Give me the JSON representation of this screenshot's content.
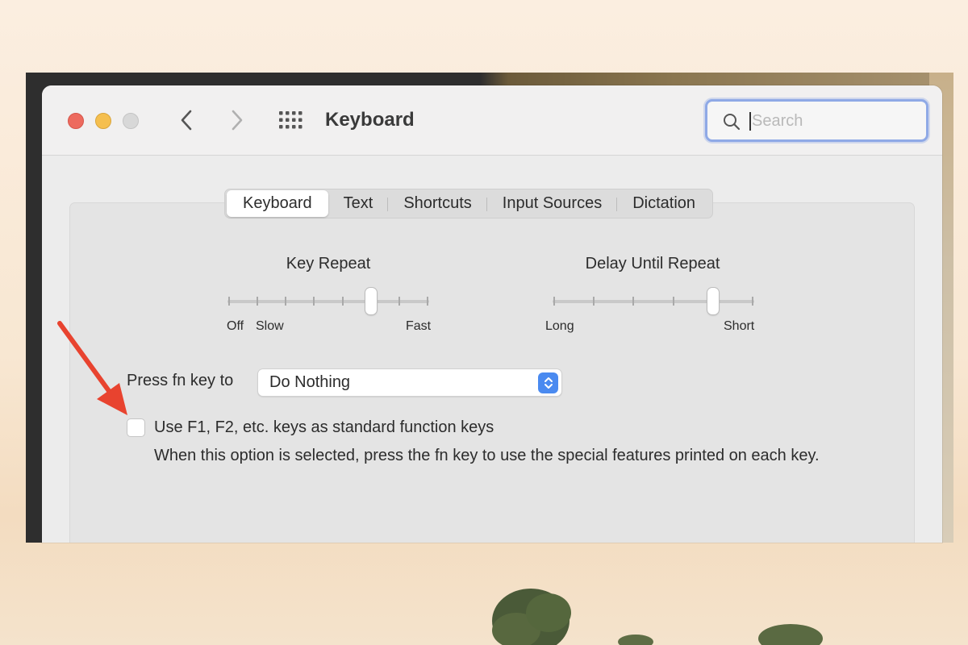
{
  "window": {
    "title": "Keyboard",
    "search_placeholder": "Search"
  },
  "tabs": [
    {
      "label": "Keyboard",
      "active": true
    },
    {
      "label": "Text",
      "active": false
    },
    {
      "label": "Shortcuts",
      "active": false
    },
    {
      "label": "Input Sources",
      "active": false
    },
    {
      "label": "Dictation",
      "active": false
    }
  ],
  "key_repeat": {
    "title": "Key Repeat",
    "label_off": "Off",
    "label_slow": "Slow",
    "label_fast": "Fast",
    "stops": 8,
    "selected_stop": 5
  },
  "delay_until_repeat": {
    "title": "Delay Until Repeat",
    "label_long": "Long",
    "label_short": "Short",
    "stops": 6,
    "selected_stop": 4
  },
  "fn_key": {
    "label": "Press fn key to",
    "selected_value": "Do Nothing"
  },
  "function_keys": {
    "checked": false,
    "label": "Use F1, F2, etc. keys as standard function keys",
    "description": "When this option is selected, press the fn key to use the special features printed on each key."
  },
  "colors": {
    "close": "#ed6a5e",
    "minimize": "#f5bf4f",
    "accent": "#4a8af0",
    "annotation_arrow": "#e8432f"
  }
}
